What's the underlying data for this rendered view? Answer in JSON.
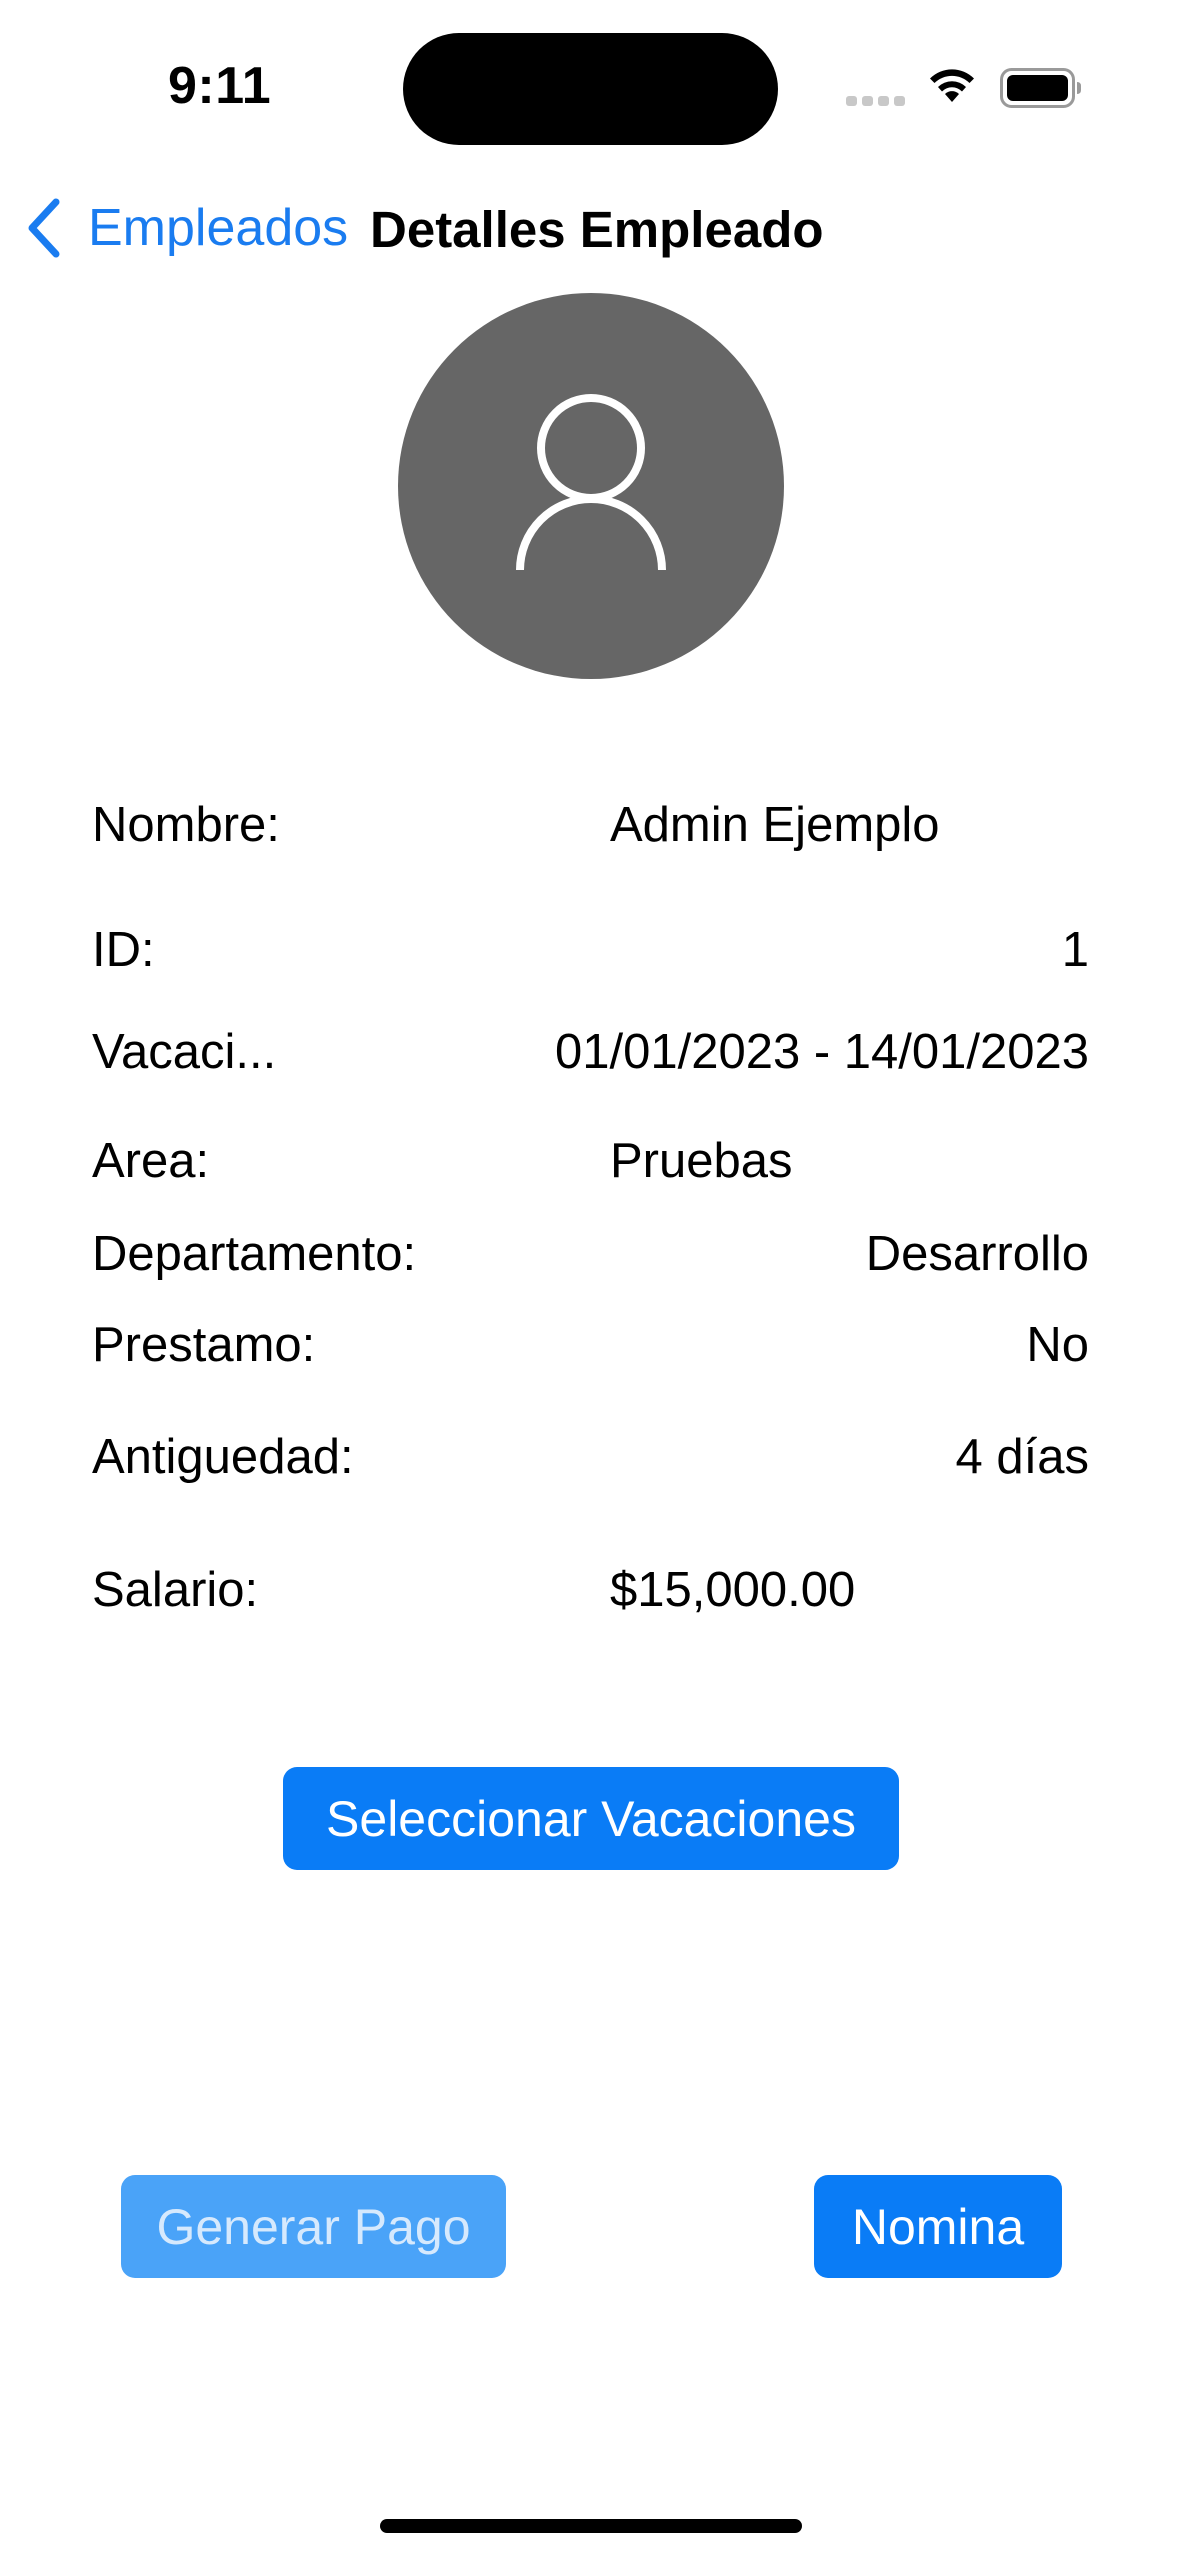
{
  "status_bar": {
    "time": "9:11",
    "icons": [
      "cellular-signal-icon",
      "wifi-icon",
      "battery-icon"
    ]
  },
  "nav": {
    "back_label": "Empleados",
    "title": "Detalles Empleado"
  },
  "details": {
    "nombre": {
      "label": "Nombre:",
      "value": "Admin Ejemplo"
    },
    "id": {
      "label": "ID:",
      "value": "1"
    },
    "vacaciones": {
      "label": "Vacaci...",
      "value": "01/01/2023 - 14/01/2023"
    },
    "area": {
      "label": "Area:",
      "value": "Pruebas"
    },
    "departamento": {
      "label": "Departamento:",
      "value": "Desarrollo"
    },
    "prestamo": {
      "label": "Prestamo:",
      "value": "No"
    },
    "antiguedad": {
      "label": "Antiguedad:",
      "value": "4 días"
    },
    "salario": {
      "label": "Salario:",
      "value": "$15,000.00"
    }
  },
  "buttons": {
    "seleccionar_vacaciones": "Seleccionar Vacaciones",
    "generar_pago": "Generar Pago",
    "nomina": "Nomina"
  },
  "colors": {
    "accent": "#0a7cf6",
    "accent_disabled": "#4aa3f8",
    "avatar_bg": "#666666"
  }
}
